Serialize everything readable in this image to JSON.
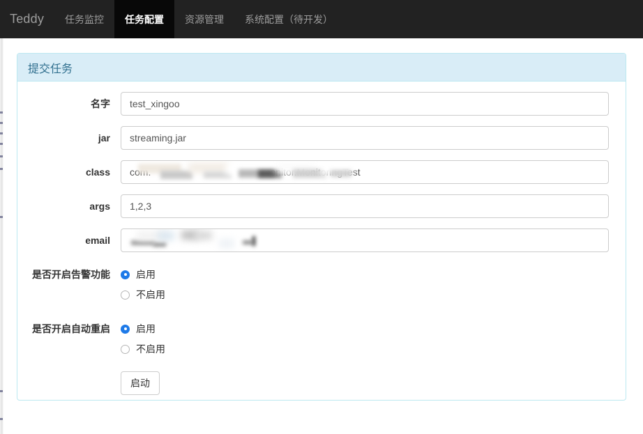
{
  "navbar": {
    "brand": "Teddy",
    "items": [
      {
        "label": "任务监控",
        "active": false
      },
      {
        "label": "任务配置",
        "active": true
      },
      {
        "label": "资源管理",
        "active": false
      },
      {
        "label": "系统配置（待开发）",
        "active": false
      }
    ]
  },
  "panel": {
    "title": "提交任务",
    "accent_color": "#d9edf7",
    "border_color": "#bce8f1",
    "title_color": "#31708f"
  },
  "form": {
    "fields": [
      {
        "label": "名字",
        "value": "test_xingoo",
        "placeholder": "",
        "redacted": false
      },
      {
        "label": "jar",
        "value": "streaming.jar",
        "placeholder": "",
        "redacted": false
      },
      {
        "label": "class",
        "value": "com.                                        .monitor.MonitoringTest",
        "placeholder": "",
        "redacted": true
      },
      {
        "label": "args",
        "value": "1,2,3",
        "placeholder": "",
        "redacted": false
      },
      {
        "label": "email",
        "value": "",
        "placeholder": "",
        "redacted": true
      }
    ],
    "radio_groups": [
      {
        "label": "是否开启告警功能",
        "options": [
          {
            "label": "启用",
            "checked": true
          },
          {
            "label": "不启用",
            "checked": false
          }
        ]
      },
      {
        "label": "是否开启自动重启",
        "options": [
          {
            "label": "启用",
            "checked": true
          },
          {
            "label": "不启用",
            "checked": false
          }
        ]
      }
    ],
    "submit_label": "启动",
    "selected_radio_color": "#1e7ae8"
  }
}
